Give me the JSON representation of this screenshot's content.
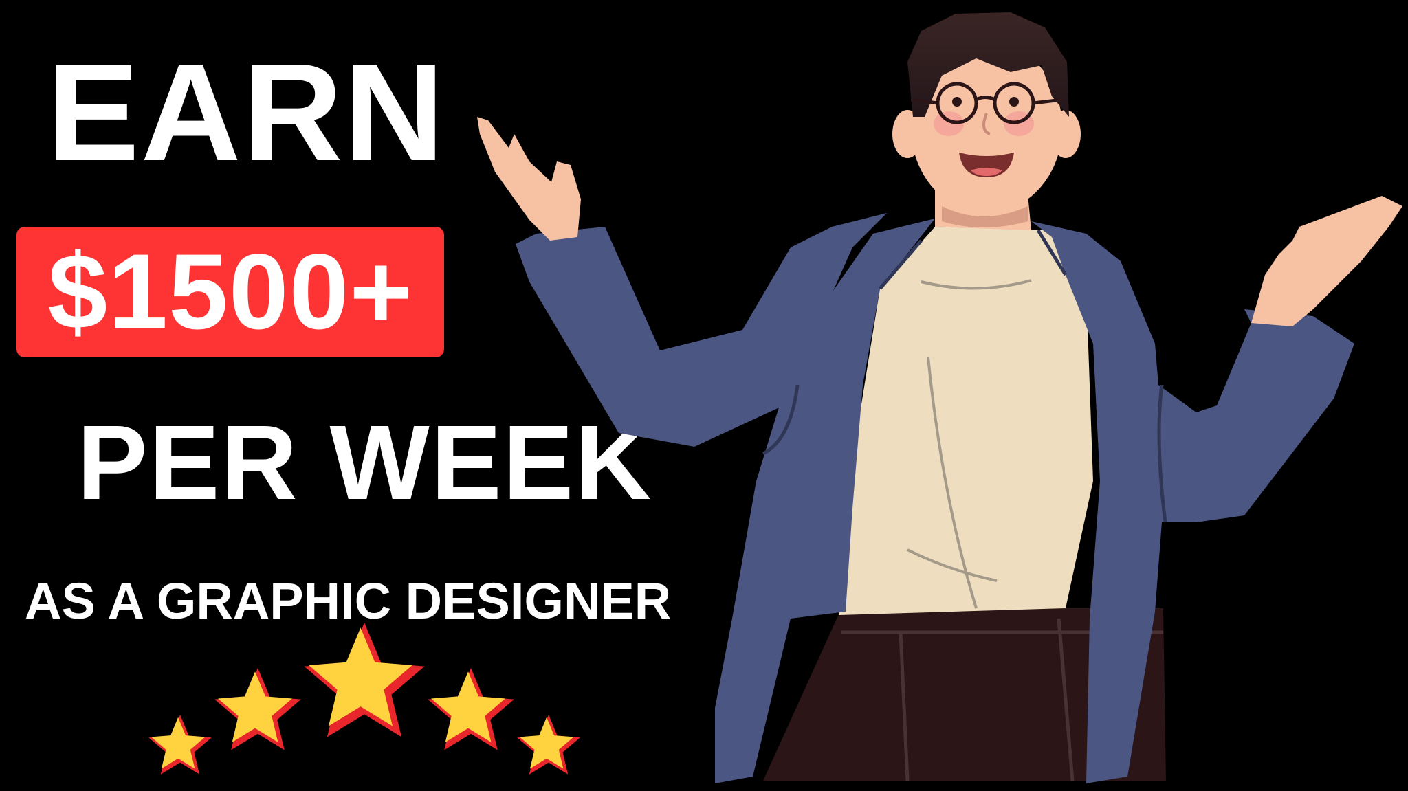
{
  "headline": {
    "line1": "EARN",
    "amount": "$1500+",
    "line3": "PER WEEK",
    "subtitle": "AS A GRAPHIC DESIGNER"
  },
  "rating": {
    "stars": 5
  },
  "colors": {
    "background": "#000000",
    "text": "#ffffff",
    "amount_box": "#fe3333",
    "star_gold": "#ffd23f",
    "star_red": "#e8262b",
    "jacket": "#4c5683",
    "shirt": "#eeddbe",
    "pants": "#2b1517",
    "skin": "#f7c1a4",
    "hair": "#2b1a19"
  },
  "illustration": {
    "subject": "smiling-man-presenting-illustration"
  }
}
